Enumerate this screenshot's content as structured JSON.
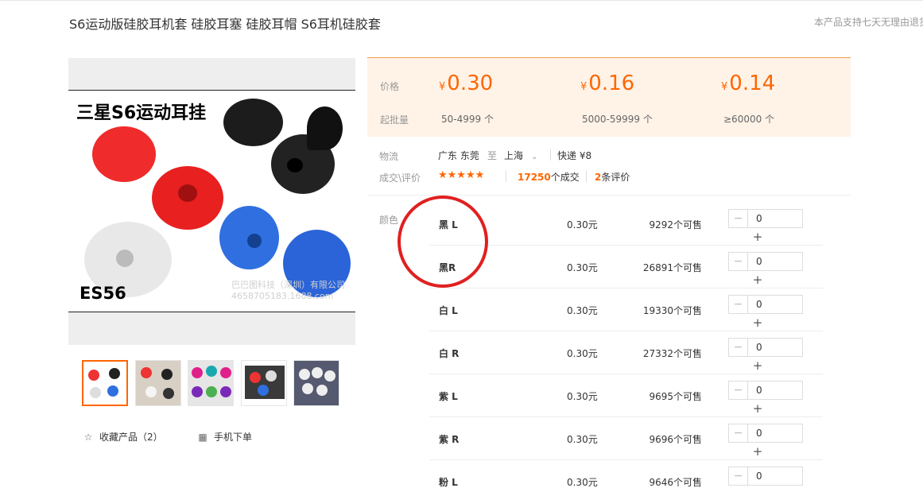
{
  "product": {
    "title": "S6运动版硅胶耳机套 硅胶耳塞 硅胶耳帽 S6耳机硅胶套",
    "notice": "本产品支持七天无理由退货"
  },
  "image": {
    "heading": "三星S6运动耳挂",
    "code": "ES56",
    "watermark_line1": "巴巴图科技（深圳）有限公司",
    "watermark_line2": "4658705183.1688.com"
  },
  "actions": {
    "favorite_label": "收藏产品（2）",
    "mobile_label": "手机下单"
  },
  "pricing": {
    "price_label": "价格",
    "moq_label": "起批量",
    "currency": "¥",
    "tiers": [
      {
        "price": "0.30",
        "qty": "50-4999 个"
      },
      {
        "price": "0.16",
        "qty": "5000-59999 个"
      },
      {
        "price": "0.14",
        "qty": "≥60000 个"
      }
    ]
  },
  "logistics": {
    "label": "物流",
    "from": "广东 东莞",
    "to_word": "至",
    "to": "上海",
    "shipping": "快递 ¥8"
  },
  "deal": {
    "label": "成交\\评价",
    "stars": "★★★★★",
    "count": "17250",
    "count_suffix": "个成交",
    "reviews": "2",
    "reviews_suffix": "条评价"
  },
  "sku": {
    "label": "颜色",
    "minus": "−",
    "plus": "+",
    "rows": [
      {
        "name": "黑 L",
        "price": "0.30元",
        "stock": "9292个可售",
        "qty": "0"
      },
      {
        "name": "黑R",
        "price": "0.30元",
        "stock": "26891个可售",
        "qty": "0"
      },
      {
        "name": "白 L",
        "price": "0.30元",
        "stock": "19330个可售",
        "qty": "0"
      },
      {
        "name": "白 R",
        "price": "0.30元",
        "stock": "27332个可售",
        "qty": "0"
      },
      {
        "name": "紫 L",
        "price": "0.30元",
        "stock": "9695个可售",
        "qty": "0"
      },
      {
        "name": "紫 R",
        "price": "0.30元",
        "stock": "9696个可售",
        "qty": "0"
      },
      {
        "name": "粉 L",
        "price": "0.30元",
        "stock": "9646个可售",
        "qty": "0"
      }
    ]
  },
  "colors": {
    "accent": "#ff6600",
    "annotation": "#e02020"
  }
}
